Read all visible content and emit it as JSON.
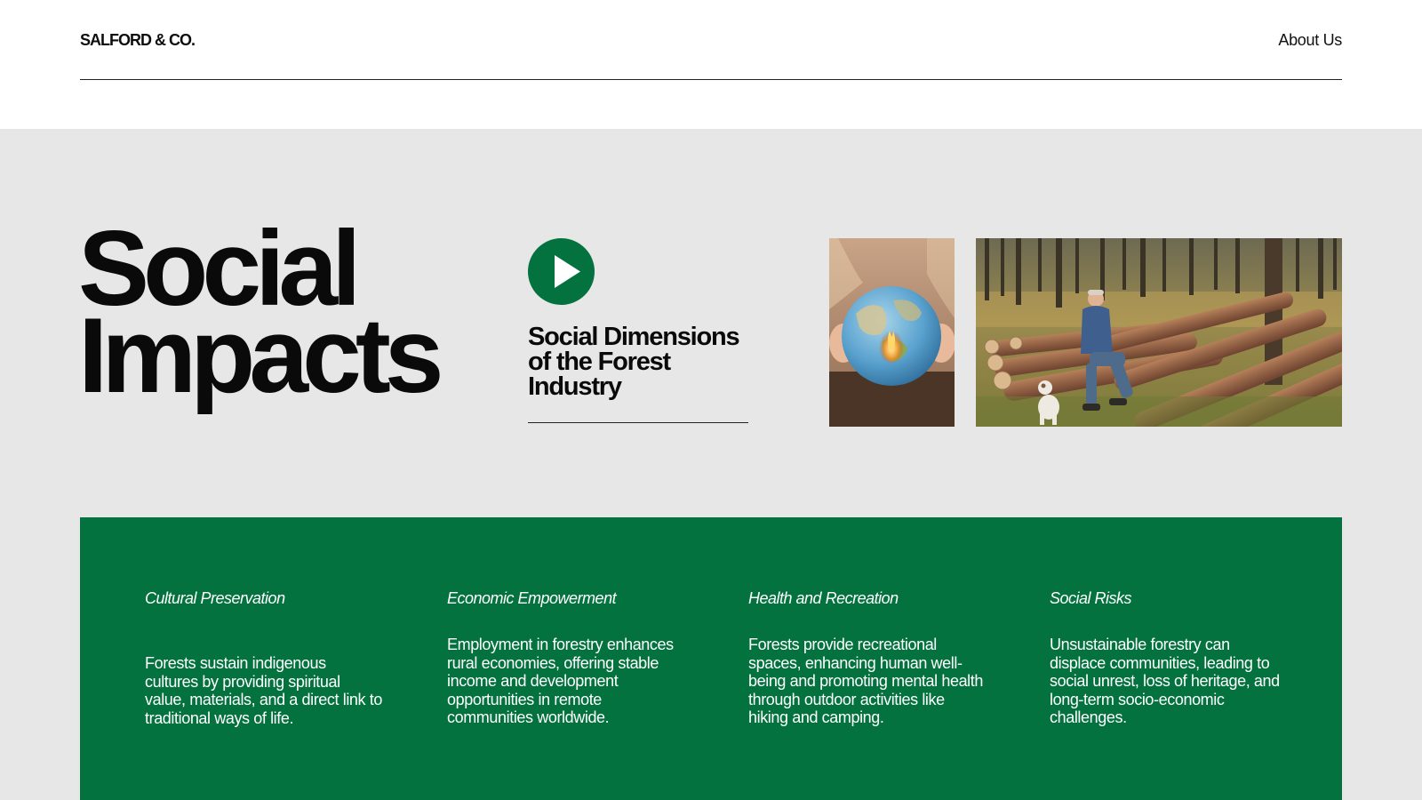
{
  "header": {
    "brand": "SALFORD & CO.",
    "nav_link": "About Us"
  },
  "hero": {
    "title_line1": "Social",
    "title_line2": "Impacts",
    "video_title": "Social Dimensions of the Forest Industry",
    "play_icon": "play-icon"
  },
  "topics": [
    {
      "heading": "Cultural Preservation",
      "text": "Forests sustain indigenous cultures by providing spiritual value, materials, and a direct link to traditional ways of life."
    },
    {
      "heading": "Economic Empowerment",
      "text": "Employment in forestry enhances rural economies, offering stable income and development opportunities in remote communities worldwide."
    },
    {
      "heading": "Health and Recreation",
      "text": "Forests provide recreational spaces, enhancing human well-being and promoting mental health through outdoor activities like hiking and camping."
    },
    {
      "heading": "Social Risks",
      "text": "Unsustainable forestry can displace communities, leading to social unrest, loss of heritage, and long-term socio-economic challenges."
    }
  ],
  "colors": {
    "accent_green": "#03723e",
    "hero_background": "#e7e7e7",
    "page_background": "#ffffff"
  }
}
